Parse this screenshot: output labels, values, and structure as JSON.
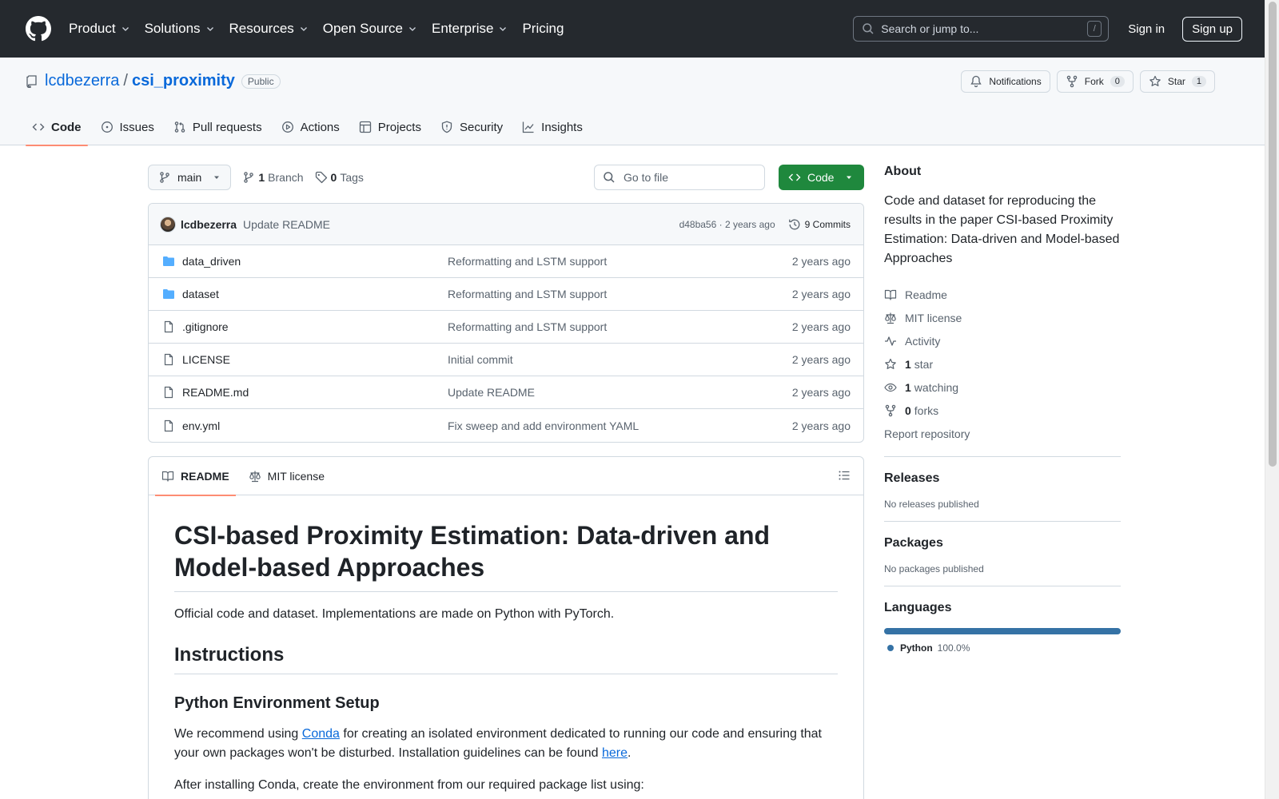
{
  "header": {
    "nav": [
      "Product",
      "Solutions",
      "Resources",
      "Open Source",
      "Enterprise",
      "Pricing"
    ],
    "search_placeholder": "Search or jump to...",
    "slash_key": "/",
    "sign_in": "Sign in",
    "sign_up": "Sign up"
  },
  "repo": {
    "owner": "lcdbezerra",
    "separator": "/",
    "name": "csi_proximity",
    "visibility": "Public",
    "notifications_label": "Notifications",
    "fork_label": "Fork",
    "fork_count": "0",
    "star_label": "Star",
    "star_count": "1",
    "tabs": [
      "Code",
      "Issues",
      "Pull requests",
      "Actions",
      "Projects",
      "Security",
      "Insights"
    ]
  },
  "file_nav": {
    "branch": "main",
    "branch_count": "1",
    "branch_label": "Branch",
    "tag_count": "0",
    "tag_label": "Tags",
    "goto_placeholder": "Go to file",
    "code_button": "Code"
  },
  "latest_commit": {
    "author": "lcdbezerra",
    "message": "Update README",
    "hash_time": "d48ba56 · 2 years ago",
    "commits_label": "9 Commits"
  },
  "files": [
    {
      "name": "data_driven",
      "type": "folder",
      "commit": "Reformatting and LSTM support",
      "age": "2 years ago"
    },
    {
      "name": "dataset",
      "type": "folder",
      "commit": "Reformatting and LSTM support",
      "age": "2 years ago"
    },
    {
      "name": ".gitignore",
      "type": "file",
      "commit": "Reformatting and LSTM support",
      "age": "2 years ago"
    },
    {
      "name": "LICENSE",
      "type": "file",
      "commit": "Initial commit",
      "age": "2 years ago"
    },
    {
      "name": "README.md",
      "type": "file",
      "commit": "Update README",
      "age": "2 years ago"
    },
    {
      "name": "env.yml",
      "type": "file",
      "commit": "Fix sweep and add environment YAML",
      "age": "2 years ago"
    }
  ],
  "readme": {
    "tab_readme": "README",
    "tab_license": "MIT license",
    "title": "CSI-based Proximity Estimation: Data-driven and Model-based Approaches",
    "intro": "Official code and dataset. Implementations are made on Python with PyTorch.",
    "h_instructions": "Instructions",
    "h_env": "Python Environment Setup",
    "p1_a": "We recommend using ",
    "p1_link1": "Conda",
    "p1_b": " for creating an isolated environment dedicated to running our code and ensuring that your own packages won't be disturbed. Installation guidelines can be found ",
    "p1_link2": "here",
    "p1_c": ".",
    "p2": "After installing Conda, create the environment from our required package list using:"
  },
  "sidebar": {
    "about_title": "About",
    "description": "Code and dataset for reproducing the results in the paper CSI-based Proximity Estimation: Data-driven and Model-based Approaches",
    "readme": "Readme",
    "license": "MIT license",
    "activity": "Activity",
    "stars_count": "1",
    "stars_label": "star",
    "watching_count": "1",
    "watching_label": "watching",
    "forks_count": "0",
    "forks_label": "forks",
    "report": "Report repository",
    "releases_title": "Releases",
    "releases_empty": "No releases published",
    "packages_title": "Packages",
    "packages_empty": "No packages published",
    "languages_title": "Languages",
    "languages": [
      {
        "name": "Python",
        "percent": "100.0%",
        "color": "#3572A5"
      }
    ]
  }
}
